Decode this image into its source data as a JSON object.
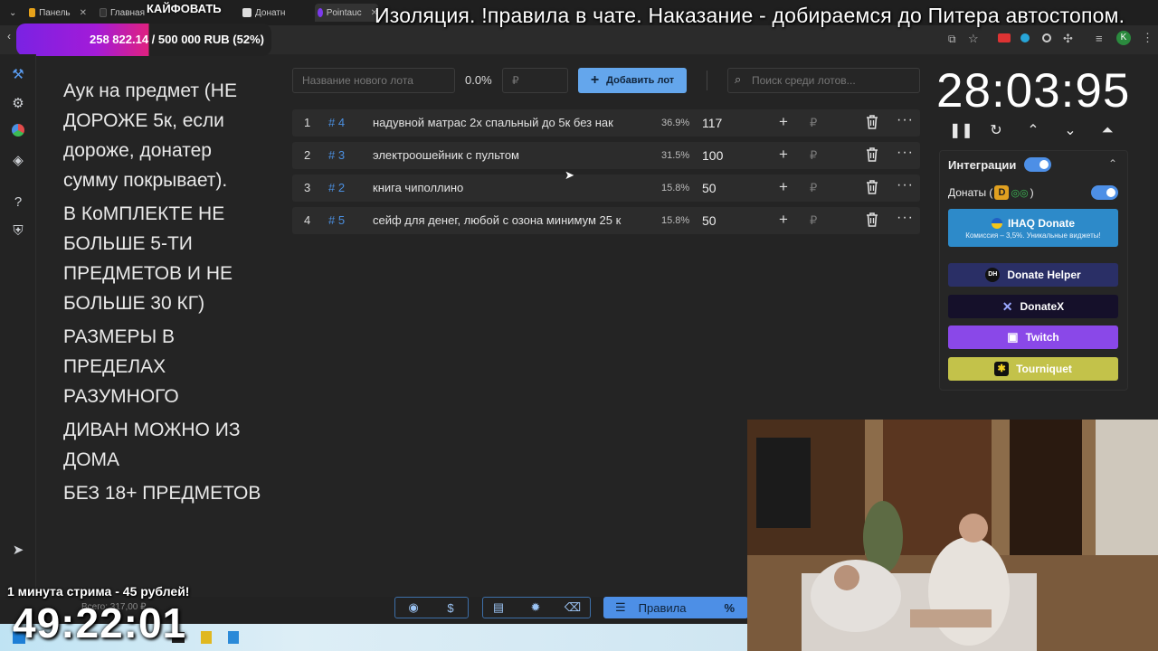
{
  "browser": {
    "tabs": [
      {
        "label": "Панель",
        "color": "#e6a21a"
      },
      {
        "label": "Главная",
        "color": "#333333"
      },
      {
        "label": "",
        "color": "#444444"
      },
      {
        "label": "Донатн",
        "color": "#2b2b2b"
      },
      {
        "label": "Pointauc",
        "color": "#7c3aed"
      }
    ],
    "kaif_label": "КАЙФОВАТЬ"
  },
  "overlay": {
    "banner": "Изоляция. !правила в чате. Наказание - добираемся до Питера автостопом.",
    "donation_progress": "258 822.14 / 500 000 RUB (52%)",
    "donation_fraction": 0.52,
    "stream_rate": "1 минута стрима - 45 рублей!",
    "stream_timer": "49:22:01",
    "total_label": "Всего: 317,00 ₽"
  },
  "rules": [
    "Аук на предмет (НЕ ДОРОЖЕ 5к, если дороже, донатер сумму покрывает).",
    "В КоМПЛЕКТЕ НЕ БОЛЬШЕ 5-ТИ ПРЕДМЕТОВ И НЕ БОЛЬШЕ 30 КГ)",
    "РАЗМЕРЫ В ПРЕДЕЛАХ РАЗУМНОГО",
    "ДИВАН МОЖНО ИЗ ДОМА",
    "БЕЗ 18+ ПРЕДМЕТОВ"
  ],
  "toolbar": {
    "new_lot_placeholder": "Название нового лота",
    "percent": "0.0%",
    "amount_placeholder": "₽",
    "add_lot_label": "Добавить лот",
    "search_placeholder": "Поиск среди лотов..."
  },
  "lots": [
    {
      "index": "1",
      "id": "# 4",
      "name": "надувной матрас 2х спальный до 5к без нак",
      "percent": "36.9%",
      "amount": "117"
    },
    {
      "index": "2",
      "id": "# 3",
      "name": "электроошейник с пультом",
      "percent": "31.5%",
      "amount": "100"
    },
    {
      "index": "3",
      "id": "# 2",
      "name": "книга чиполлино",
      "percent": "15.8%",
      "amount": "50"
    },
    {
      "index": "4",
      "id": "# 5",
      "name": "сейф для денег, любой с озона минимум 25 к",
      "percent": "15.8%",
      "amount": "50"
    }
  ],
  "timer": {
    "value": "28:03:95"
  },
  "integrations": {
    "title": "Интеграции",
    "donations_label": "Донаты (",
    "donations_label_end": ")",
    "services": [
      {
        "label": "IHAQ Donate",
        "sub": "Комиссия – 3,5%. Уникальные виджеты!",
        "color": "#2d8ac9"
      },
      {
        "label": "Donate Helper",
        "color": "#2a2f66"
      },
      {
        "label": "DonateX",
        "color": "#15102a"
      },
      {
        "label": "Twitch",
        "color": "#8a48e8"
      },
      {
        "label": "Tourniquet",
        "color": "#c3c24a"
      }
    ]
  },
  "bottom": {
    "rules_button": "Правила",
    "percent_button": "%"
  }
}
